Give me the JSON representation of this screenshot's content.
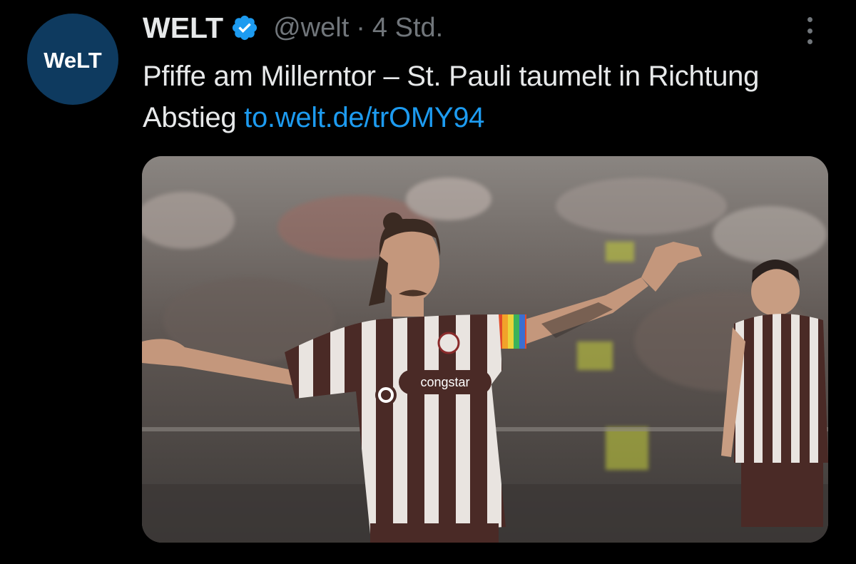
{
  "author": {
    "avatar_text": "WeLT",
    "display_name": "WELT",
    "handle": "@welt",
    "separator": "·",
    "time": "4 Std."
  },
  "tweet": {
    "text": "Pfiffe am Millerntor – St. Pauli taumelt in Richtung Abstieg",
    "link": "to.welt.de/trOMY94"
  },
  "media": {
    "sponsor_text": "congstar"
  },
  "colors": {
    "background": "#000000",
    "text": "#e7e9ea",
    "secondary": "#71767b",
    "link": "#1d9bf0",
    "verified": "#1d9bf0",
    "avatar_bg": "#0e3a5f",
    "jersey_brown": "#4a2a26"
  },
  "icons": [
    "verified-badge-icon",
    "more-options-icon"
  ]
}
